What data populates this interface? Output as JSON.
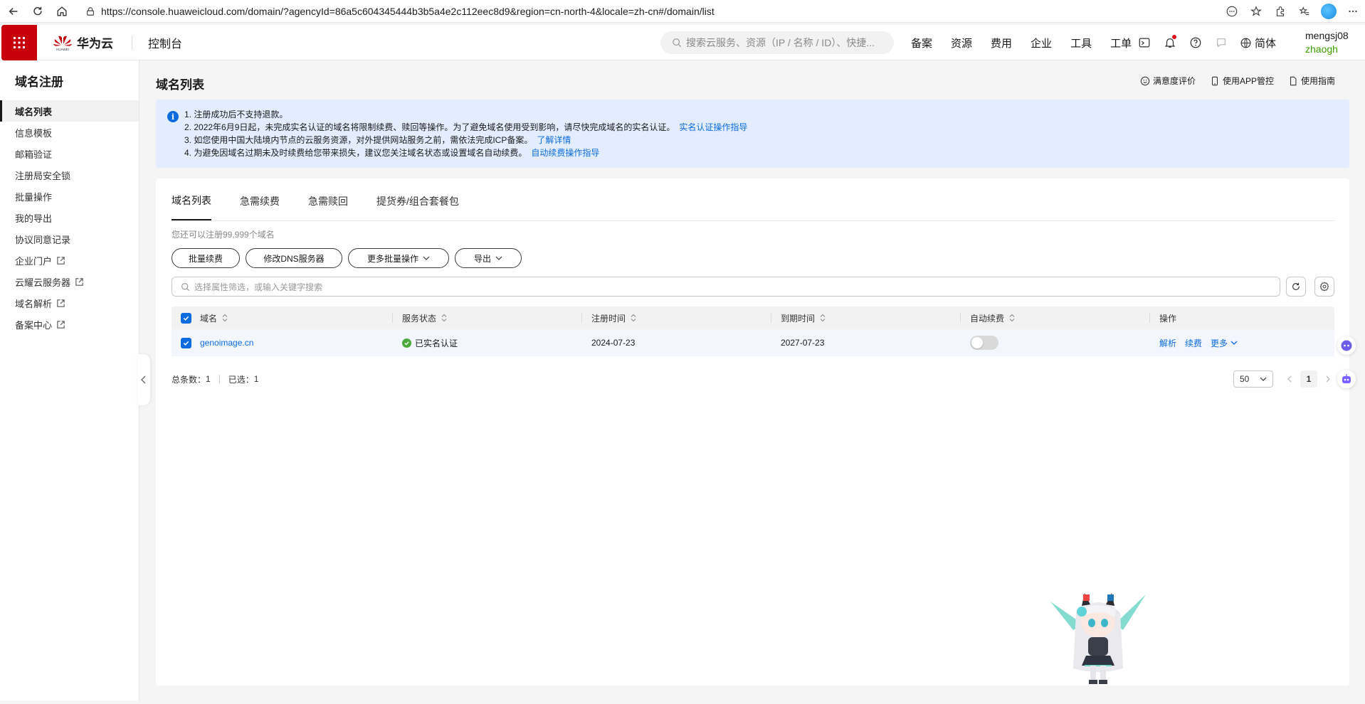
{
  "browser": {
    "url": "https://console.huaweicloud.com/domain/?agencyId=86a5c604345444b3b5a4e2c112eec8d9&region=cn-north-4&locale=zh-cn#/domain/list"
  },
  "topbar": {
    "brand": "华为云",
    "brand_sub": "HUAWEI",
    "console": "控制台",
    "search_placeholder": "搜索云服务、资源（IP / 名称 / ID）、快捷...",
    "menu": [
      "备案",
      "资源",
      "费用",
      "企业",
      "工具",
      "工单"
    ],
    "lang": "简体",
    "user_name": "mengsj08",
    "user_sub": "zhaogh"
  },
  "sidebar": {
    "title": "域名注册",
    "items": [
      {
        "label": "域名列表",
        "external": false
      },
      {
        "label": "信息模板",
        "external": false
      },
      {
        "label": "邮箱验证",
        "external": false
      },
      {
        "label": "注册局安全锁",
        "external": false
      },
      {
        "label": "批量操作",
        "external": false
      },
      {
        "label": "我的导出",
        "external": false
      },
      {
        "label": "协议同意记录",
        "external": false
      },
      {
        "label": "企业门户",
        "external": true
      },
      {
        "label": "云耀云服务器",
        "external": true
      },
      {
        "label": "域名解析",
        "external": true
      },
      {
        "label": "备案中心",
        "external": true
      }
    ]
  },
  "page": {
    "title": "域名列表",
    "actions": [
      "满意度评价",
      "使用APP管控",
      "使用指南"
    ]
  },
  "notice": {
    "lines": [
      {
        "text": "1. 注册成功后不支持退款。",
        "link": ""
      },
      {
        "text": "2. 2022年6月9日起，未完成实名认证的域名将限制续费、赎回等操作。为了避免域名使用受到影响，请尽快完成域名的实名认证。",
        "link": "实名认证操作指导"
      },
      {
        "text": "3. 如您使用中国大陆境内节点的云服务资源，对外提供网站服务之前，需依法完成ICP备案。",
        "link": "了解详情"
      },
      {
        "text": "4. 为避免因域名过期未及时续费给您带来损失，建议您关注域名状态或设置域名自动续费。",
        "link": "自动续费操作指导"
      }
    ]
  },
  "tabs": [
    "域名列表",
    "急需续费",
    "急需赎回",
    "提货券/组合套餐包"
  ],
  "quota_text": "您还可以注册99,999个域名",
  "buttons": {
    "batch_renew": "批量续费",
    "modify_dns": "修改DNS服务器",
    "more_batch": "更多批量操作",
    "export": "导出"
  },
  "filter_placeholder": "选择属性筛选，或输入关键字搜索",
  "table": {
    "columns": [
      "域名",
      "服务状态",
      "注册时间",
      "到期时间",
      "自动续费",
      "操作"
    ],
    "rows": [
      {
        "domain": "genoimage.cn",
        "status": "已实名认证",
        "registered": "2024-07-23",
        "expires": "2027-07-23",
        "auto_renew": false,
        "ops": [
          "解析",
          "续费",
          "更多"
        ]
      }
    ]
  },
  "footer": {
    "total_label": "总条数：",
    "total": "1",
    "selected_label": "已选：",
    "selected": "1",
    "page_size": "50",
    "current_page": "1"
  }
}
